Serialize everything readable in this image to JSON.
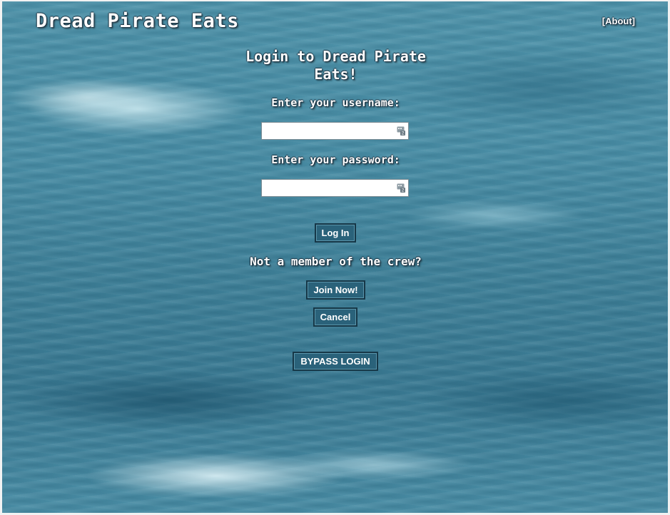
{
  "header": {
    "site_title": "Dread Pirate Eats",
    "about_link": "[About]"
  },
  "login": {
    "heading": "Login to Dread Pirate Eats!",
    "username_label": "Enter your username:",
    "username_value": "",
    "password_label": "Enter your password:",
    "password_value": "",
    "login_button": "Log In",
    "not_member_text": "Not a member of the crew?",
    "join_button": "Join Now!",
    "cancel_button": "Cancel",
    "bypass_button": "BYPASS LOGIN"
  },
  "icons": {
    "field_icon": "autofill-key-icon"
  },
  "colors": {
    "button_bg": "#2a627a",
    "button_border": "#163747",
    "text": "#ffffff",
    "background": "#4a8fa7"
  }
}
